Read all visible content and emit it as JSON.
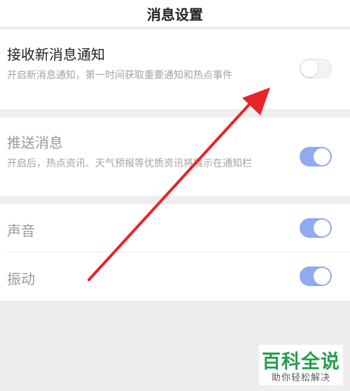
{
  "header": {
    "title": "消息设置"
  },
  "settings": {
    "new_message": {
      "title": "接收新消息通知",
      "desc": "开启新消息通知，第一时间获取重要通知和热点事件",
      "enabled": false
    },
    "push": {
      "title": "推送消息",
      "desc": "开启后，热点资讯、天气预报等优质资讯将展示在通知栏",
      "enabled": true
    },
    "sound": {
      "title": "声音",
      "enabled": true
    },
    "vibrate": {
      "title": "振动",
      "enabled": true
    }
  },
  "colors": {
    "toggle_on": "#8faaf0",
    "toggle_off": "#f3f3f3",
    "arrow": "#e8232a",
    "watermark": "#1e9a45"
  },
  "watermark": {
    "main": "百科全说",
    "sub": "助你轻松解决"
  }
}
